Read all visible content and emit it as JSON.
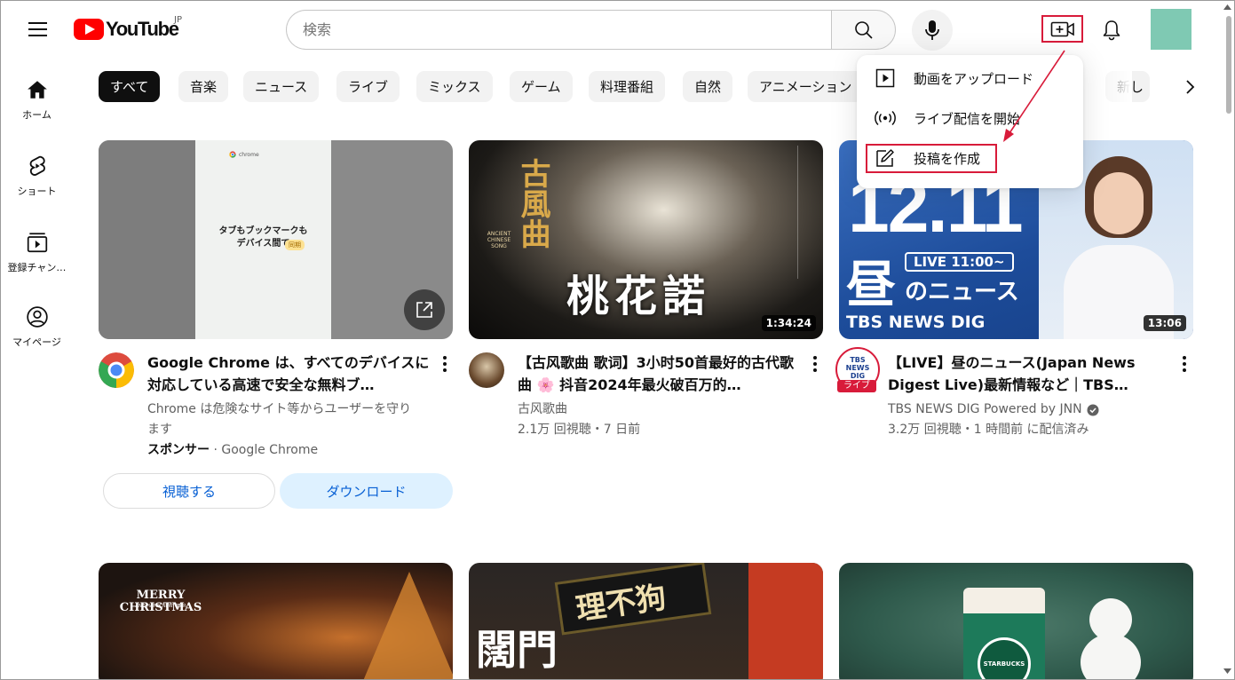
{
  "header": {
    "logo_text": "YouTube",
    "region": "JP",
    "search_placeholder": "検索"
  },
  "sidebar": [
    {
      "label": "ホーム",
      "icon": "home-icon"
    },
    {
      "label": "ショート",
      "icon": "shorts-icon"
    },
    {
      "label": "登録チャン…",
      "icon": "subscriptions-icon"
    },
    {
      "label": "マイページ",
      "icon": "my-page-icon"
    }
  ],
  "chips": [
    "すべて",
    "音楽",
    "ニュース",
    "ライブ",
    "ミックス",
    "ゲーム",
    "料理番組",
    "自然",
    "アニメーション",
    "新し"
  ],
  "create_menu": {
    "items": [
      "動画をアップロード",
      "ライブ配信を開始",
      "投稿を作成"
    ]
  },
  "videos": [
    {
      "title": "Google Chrome は、すべてのデバイスに対応している高速で安全な無料ブ…",
      "description": "Chrome は危険なサイト等からユーザーを守ります",
      "sponsor_label": "スポンサー",
      "sponsor_name": "· Google Chrome",
      "thumb_text": "タブもブックマークも\nデバイス間で",
      "thumb_badge": "同期",
      "thumb_brand": "chrome",
      "watch_button": "視聴する",
      "download_button": "ダウンロード"
    },
    {
      "title": "【古风歌曲 歌词】3小时50首最好的古代歌曲 🌸 抖音2024年最火破百万的…",
      "channel": "古风歌曲",
      "stats": "2.1万 回視聴・7 日前",
      "duration": "1:34:24",
      "thumb_big": "桃花諾",
      "thumb_left": "古風曲",
      "thumb_song": "ANCIENT CHINESE SONG"
    },
    {
      "title": "【LIVE】昼のニュース(Japan News Digest Live)最新情報など｜TBS NEW…",
      "channel": "TBS NEWS DIG Powered by JNN",
      "stats": "3.2万 回視聴・1 時間前 に配信済み",
      "duration": "13:06",
      "thumb_date": "12.11",
      "thumb_kanji": "昼",
      "thumb_news": "のニュース",
      "thumb_live": "LIVE 11:00~",
      "thumb_footer": "TBS NEWS DIG",
      "live_badge": "ライブ",
      "avatar_text": "TBS NEWS DIG"
    }
  ],
  "row2": [
    {
      "thumb_text": "MERRY CHRISTMAS",
      "thumb_sub": "AND HAPPY NEW YEAR"
    },
    {
      "thumb_text": "闊門",
      "thumb_sign": "理不狗"
    },
    {
      "thumb_text": "STARBUCKS"
    }
  ]
}
